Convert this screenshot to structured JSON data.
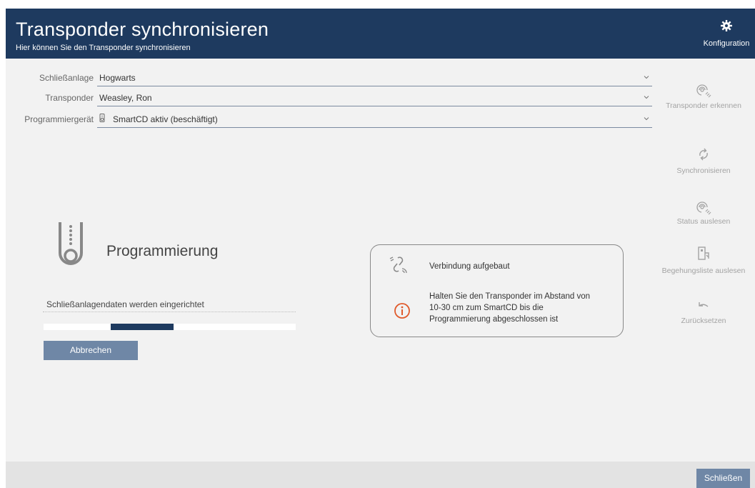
{
  "header": {
    "title": "Transponder synchronisieren",
    "subtitle": "Hier können Sie den Transponder synchronisieren",
    "config_label": "Konfiguration"
  },
  "form": {
    "fields": [
      {
        "label": "Schließanlage",
        "value": "Hogwarts"
      },
      {
        "label": "Transponder",
        "value": "Weasley, Ron"
      },
      {
        "label": "Programmiergerät",
        "value": "SmartCD aktiv (beschäftigt)"
      }
    ]
  },
  "side_actions": {
    "detect": "Transponder erkennen",
    "sync": "Synchronisieren",
    "read_status": "Status auslesen",
    "read_access_list": "Begehungsliste auslesen",
    "reset": "Zurücksetzen"
  },
  "programming": {
    "title": "Programmierung",
    "status": "Schließanlagendaten werden eingerichtet",
    "cancel_label": "Abbrechen",
    "progress": {
      "start": 0.265,
      "end": 0.515
    }
  },
  "info": {
    "connection": "Verbindung aufgebaut",
    "hint_lines": [
      "Halten Sie den Transponder im Abstand von",
      "10-30 cm zum SmartCD bis die",
      "Programmierung abgeschlossen ist"
    ]
  },
  "footer": {
    "close_label": "Schließen"
  },
  "colors": {
    "header_bg": "#1e3a5f",
    "button_bg": "#6f87a6",
    "warning": "#e05a2b"
  }
}
